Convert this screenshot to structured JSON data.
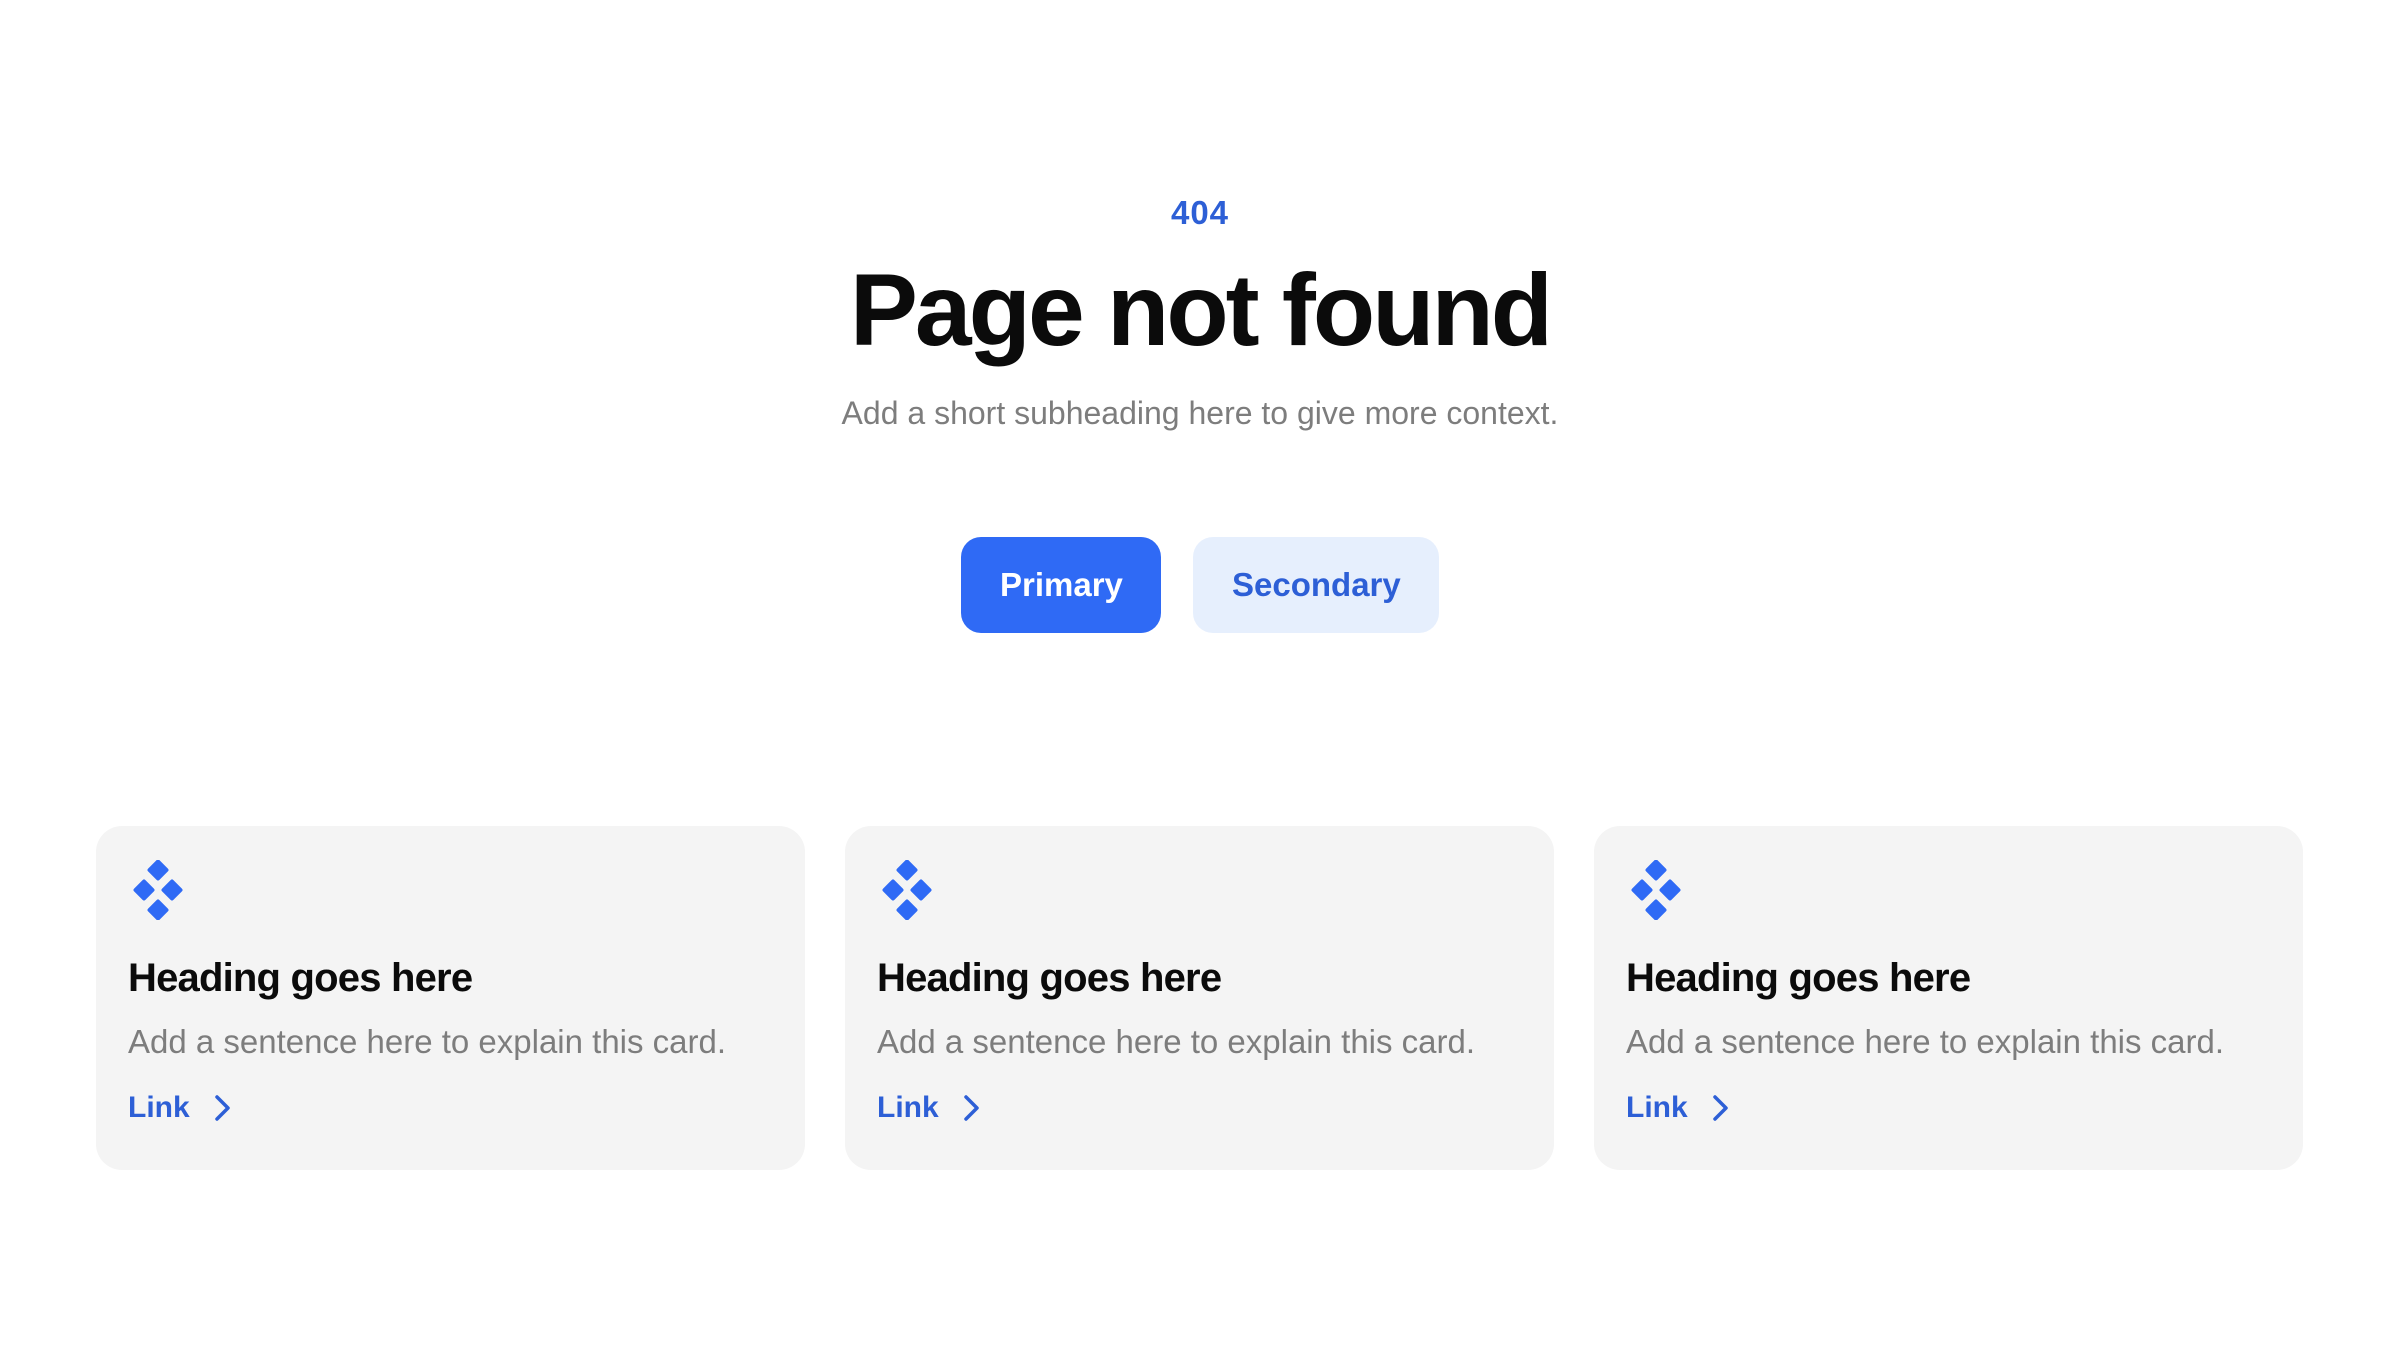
{
  "hero": {
    "code": "404",
    "title": "Page not found",
    "subheading": "Add a short subheading here to give more context."
  },
  "buttons": {
    "primary_label": "Primary",
    "secondary_label": "Secondary"
  },
  "cards": [
    {
      "icon": "diamond-grid-icon",
      "heading": "Heading goes here",
      "text": "Add a sentence here to explain this card.",
      "link_label": "Link"
    },
    {
      "icon": "diamond-grid-icon",
      "heading": "Heading goes here",
      "text": "Add a sentence here to explain this card.",
      "link_label": "Link"
    },
    {
      "icon": "diamond-grid-icon",
      "heading": "Heading goes here",
      "text": "Add a sentence here to explain this card.",
      "link_label": "Link"
    }
  ],
  "colors": {
    "accent": "#2f6af5",
    "accent_text": "#2d5fd6",
    "secondary_bg": "#e6effd",
    "card_bg": "#f4f4f4",
    "muted_text": "#7d7d7d"
  }
}
